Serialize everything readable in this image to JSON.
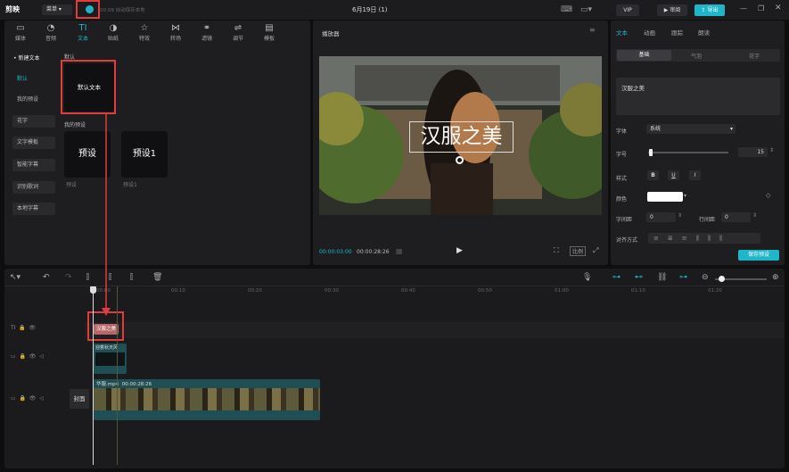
{
  "topbar": {
    "app_name": "剪映",
    "menu_label": "菜单",
    "save_status": "00:09 自动保存本地",
    "project_title": "6月19日 (1)",
    "vip_label": "VIP",
    "review_label": "审阅",
    "export_label": "导出"
  },
  "tool_tabs": [
    {
      "label": "媒体",
      "icon": "▭"
    },
    {
      "label": "音频",
      "icon": "◔"
    },
    {
      "label": "文本",
      "icon": "TI"
    },
    {
      "label": "贴纸",
      "icon": "◑"
    },
    {
      "label": "特效",
      "icon": "☆"
    },
    {
      "label": "转场",
      "icon": "⋈"
    },
    {
      "label": "滤镜",
      "icon": "⚭"
    },
    {
      "label": "调节",
      "icon": "⇌"
    },
    {
      "label": "模板",
      "icon": "▤"
    }
  ],
  "text_sidebar": [
    "• 新建文本",
    "默认",
    "我的预设",
    "花字",
    "文字模板",
    "智能字幕",
    "识别歌词",
    "本地字幕"
  ],
  "default_section": {
    "title": "默认",
    "card_label": "默认文本"
  },
  "preset_section": {
    "title": "我的预设",
    "cards": [
      {
        "text": "预设",
        "caption": "预设"
      },
      {
        "text": "预设1",
        "caption": "预设1"
      }
    ]
  },
  "player": {
    "title": "播放器",
    "overlay_text": "汉服之美",
    "current_time": "00:00:03:00",
    "total_time": "00:00:28:26",
    "ratio_label": "比例"
  },
  "props": {
    "tabs": [
      "文本",
      "动画",
      "跟踪",
      "朗读"
    ],
    "subtabs": [
      "基础",
      "气泡",
      "花字"
    ],
    "text_value": "汉服之美",
    "font_label": "字体",
    "font_value": "系统",
    "size_label": "字号",
    "size_value": "15",
    "style_label": "样式",
    "style_buttons": [
      "B",
      "U",
      "I"
    ],
    "color_label": "颜色",
    "letter_spacing_label": "字间距",
    "letter_spacing_value": "0",
    "line_spacing_label": "行间距",
    "line_spacing_value": "0",
    "align_label": "对齐方式",
    "save_preset_label": "保存预设"
  },
  "timeline": {
    "ruler_labels": [
      "00:00",
      "00:10",
      "00:20",
      "00:30",
      "00:40",
      "00:50",
      "01:00",
      "01:10",
      "01:20"
    ],
    "text_clip": "汉服之美",
    "effect_clip": "迎着秋天风",
    "video_clip_name": "华服.mp4",
    "video_clip_duration": "00:00:28:26",
    "cover_label": "封面"
  },
  "colors": {
    "accent": "#1fb6c9",
    "highlight": "#e03c3c",
    "video_track": "#1f4f54",
    "text_clip": "#b9666a"
  }
}
